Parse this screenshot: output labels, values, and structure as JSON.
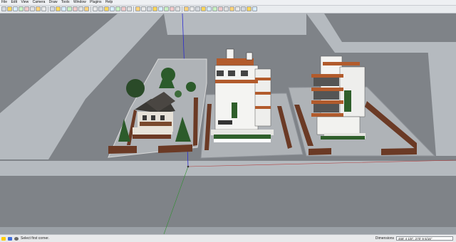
{
  "menu": [
    "File",
    "Edit",
    "View",
    "Camera",
    "Draw",
    "Tools",
    "Window",
    "Plugins",
    "Help"
  ],
  "toolbar_icons": [
    "select-arrow",
    "pencil",
    "rectangle",
    "circle",
    "arc",
    "eraser",
    "paint-bucket",
    "tape-measure",
    "push-pull",
    "move",
    "rotate",
    "follow-me",
    "offset",
    "text",
    "axes",
    "orbit",
    "pan",
    "zoom",
    "zoom-window",
    "zoom-extents",
    "previous-view",
    "next-view",
    "iso-view",
    "top-view",
    "front-view",
    "right-view",
    "back-view",
    "left-view",
    "xray",
    "wireframe",
    "hidden-line",
    "shaded",
    "textured",
    "monochrome",
    "component",
    "section-plane",
    "layer",
    "style",
    "shadow",
    "fog",
    "walk",
    "look-around",
    "position-camera"
  ],
  "status": {
    "hint": "Select first corner.",
    "measure_label": "Dimensions",
    "measure_value": "468' 4 1/8\", 270' 9 5/16\""
  },
  "colors": {
    "ground": "#7f8388",
    "road": "#b5babf",
    "lot": "#afb3b7",
    "wall_top": "#9a9ea3",
    "wall_face": "#6b3a25",
    "building_white": "#f4f4f2",
    "accent_orange": "#b25b2c",
    "tree_green": "#2a5a2a"
  }
}
